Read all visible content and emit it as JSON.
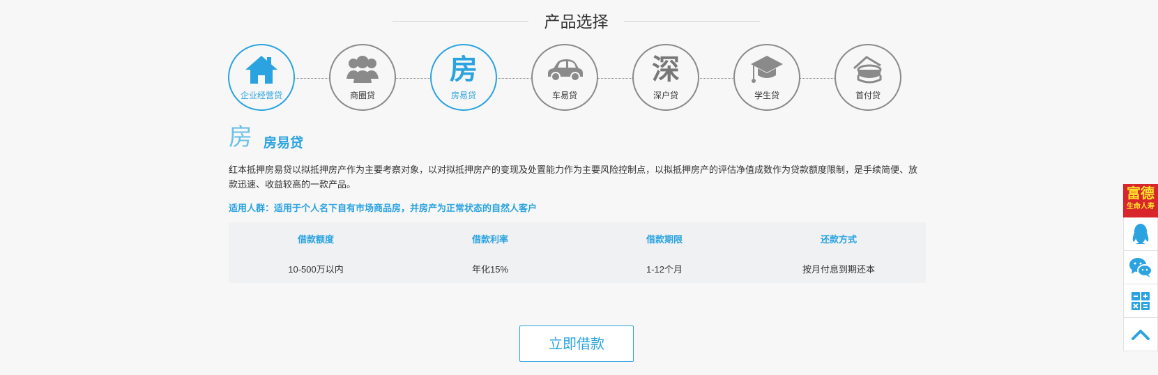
{
  "section_title": "产品选择",
  "products": [
    {
      "label": "企业经营贷",
      "icon": "house-icon",
      "active": true
    },
    {
      "label": "商圈贷",
      "icon": "people-group-icon",
      "active": false
    },
    {
      "label": "房易贷",
      "icon": "fang-character-icon",
      "glyph": "房",
      "active": true
    },
    {
      "label": "车易贷",
      "icon": "car-icon",
      "active": false
    },
    {
      "label": "深户贷",
      "icon": "shen-character-icon",
      "glyph": "深",
      "active": false
    },
    {
      "label": "学生贷",
      "icon": "graduation-cap-icon",
      "active": false
    },
    {
      "label": "首付贷",
      "icon": "coins-icon",
      "active": false
    }
  ],
  "detail": {
    "icon_glyph": "房",
    "name": "房易贷",
    "description": "红本抵押房易贷以拟抵押房产作为主要考察对象，以对拟抵押房产的变现及处置能力作为主要风险控制点，以拟抵押房产的评估净值成数作为贷款额度限制，是手续简便、放款迅速、收益较高的一款产品。",
    "target": "适用人群：适用于个人名下自有市场商品房，并房产为正常状态的自然人客户",
    "table": {
      "headers": [
        "借款额度",
        "借款利率",
        "借款期限",
        "还款方式"
      ],
      "values": [
        "10-500万以内",
        "年化15%",
        "1-12个月",
        "按月付息到期还本"
      ]
    }
  },
  "apply_label": "立即借款",
  "float_bar": {
    "brand_line1": "富德",
    "brand_line2": "生命人寿",
    "items": [
      "qq-icon",
      "wechat-icon",
      "calculator-icon",
      "back-to-top-icon"
    ]
  },
  "colors": {
    "accent": "#2aa3e0",
    "brand_red": "#d8262c",
    "brand_yellow": "#ffe32a",
    "inactive": "#8a8a8a"
  }
}
